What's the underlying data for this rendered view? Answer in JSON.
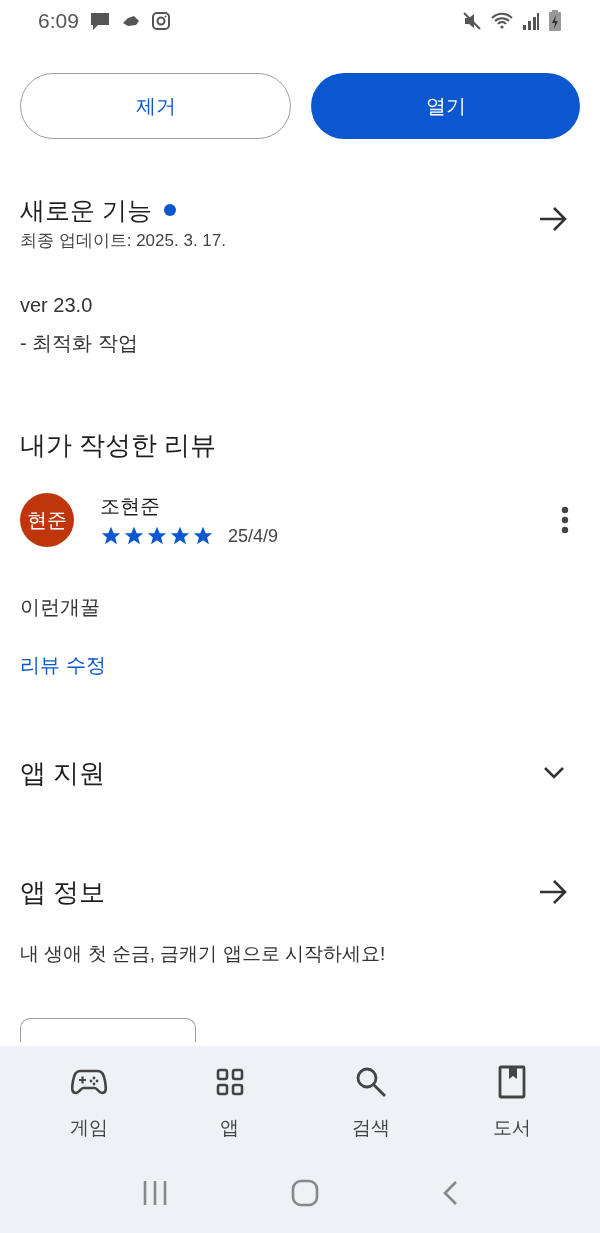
{
  "status_bar": {
    "time": "6:09"
  },
  "actions": [
    {
      "label": "제거",
      "kind": "outline"
    },
    {
      "label": "열기",
      "kind": "filled"
    }
  ],
  "whats_new": {
    "title": "새로운 기능",
    "new_indicator": true,
    "updated": "최종 업데이트: 2025. 3. 17.",
    "lines": [
      "ver 23.0",
      "- 최적화 작업"
    ]
  },
  "my_review": {
    "title": "내가 작성한 리뷰",
    "avatar_text": "현준",
    "author": "조현준",
    "stars": 5,
    "date": "25/4/9",
    "text": "이런개꿀",
    "edit_link": "리뷰 수정"
  },
  "app_support": {
    "title": "앱 지원",
    "expanded": false
  },
  "app_info": {
    "title": "앱 정보",
    "description": "내 생애 첫 순금, 금캐기 앱으로 시작하세요!"
  },
  "bottom_nav": [
    {
      "label": "게임",
      "kind": "gamepad",
      "selected": false
    },
    {
      "label": "앱",
      "kind": "apps",
      "selected": false
    },
    {
      "label": "검색",
      "kind": "search",
      "selected": false
    },
    {
      "label": "도서",
      "kind": "book",
      "selected": false
    }
  ]
}
